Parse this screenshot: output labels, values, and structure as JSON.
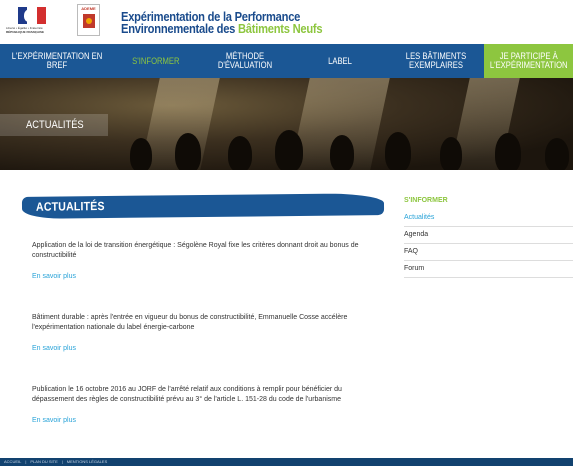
{
  "header": {
    "title_line1": "Expérimentation de la Performance",
    "title_line2_part1": "Environnementale des ",
    "title_line2_part2": "Bâtiments Neufs",
    "rf_motto": "Liberté • Égalité • Fraternité",
    "rf_label": "RÉPUBLIQUE FRANÇAISE",
    "ademe_label": "ADEME"
  },
  "nav": {
    "items": [
      {
        "label": "L'EXPÉRIMENTATION EN BREF"
      },
      {
        "label": "S'INFORMER"
      },
      {
        "label": "MÉTHODE D'ÉVALUATION"
      },
      {
        "label": "LABEL"
      },
      {
        "label": "LES BÂTIMENTS EXEMPLAIRES"
      },
      {
        "label": "JE PARTICIPE À L'EXPÉRIMENTATION"
      }
    ]
  },
  "banner": {
    "label": "ACTUALITÉS"
  },
  "main": {
    "section_title": "ACTUALITÉS",
    "news": [
      {
        "text": "Application de la loi de transition énergétique : Ségolène Royal fixe les critères donnant droit au bonus de constructibilité",
        "more": "En savoir plus"
      },
      {
        "text": "Bâtiment durable : après l'entrée en vigueur du bonus de constructibilité, Emmanuelle Cosse accélère l'expérimentation nationale du label énergie-carbone",
        "more": "En savoir plus"
      },
      {
        "text": "Publication le 16 octobre 2016 au JORF de l'arrêté relatif aux conditions à remplir pour bénéficier du dépassement des règles de constructibilité prévu au 3° de l'article L. 151-28 du code de l'urbanisme",
        "more": "En savoir plus"
      }
    ]
  },
  "sidebar": {
    "title": "S'INFORMER",
    "items": [
      {
        "label": "Actualités"
      },
      {
        "label": "Agenda"
      },
      {
        "label": "FAQ"
      },
      {
        "label": "Forum"
      }
    ]
  },
  "footer": {
    "links": [
      "ACCUEIL",
      "PLAN DU SITE",
      "MENTIONS LÉGALES"
    ]
  },
  "colors": {
    "nav_bg": "#1b5795",
    "accent_green": "#8dc63f",
    "link_blue": "#29a3d8",
    "footer_bg": "#12426f"
  }
}
